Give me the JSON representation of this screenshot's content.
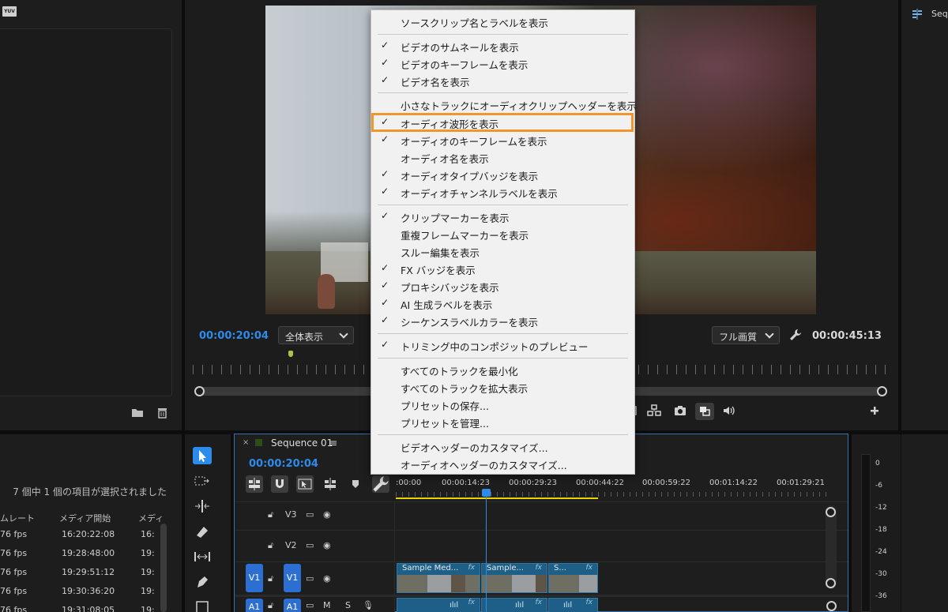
{
  "project_panel": {
    "badge": "YUV",
    "selection_status": "7 個中 1 個の項目が選択されました",
    "columns": [
      "ムレート",
      "メディア開始",
      "メディ"
    ],
    "rows": [
      [
        "76 fps",
        "16:20:22:08",
        "16:"
      ],
      [
        "76 fps",
        "19:28:48:00",
        "19:"
      ],
      [
        "76 fps",
        "19:29:51:12",
        "19:"
      ],
      [
        "76 fps",
        "19:30:36:20",
        "19:"
      ],
      [
        "76 fps",
        "19:31:08:05",
        "19:"
      ]
    ]
  },
  "program_monitor": {
    "timecode_current": "00:00:20:04",
    "fit_select": "全体表示",
    "quality_select": "フル画質",
    "timecode_duration": "00:00:45:13"
  },
  "right_panel": {
    "sequence_label": "Seq"
  },
  "timeline": {
    "sequence_name": "Sequence 01",
    "timecode": "00:00:20:04",
    "ruler": ":00:00",
    "r1": "00:00:14:23",
    "r2": "00:00:29:23",
    "r3": "00:00:44:22",
    "r4": "00:00:59:22",
    "r5": "00:01:14:22",
    "r6": "00:01:29:21",
    "tracks": {
      "v3": "V3",
      "v2": "V2",
      "v1_src": "V1",
      "v1": "V1",
      "a1_src": "A1",
      "a1": "A1"
    },
    "clips": [
      "Sample Med...",
      "Sample...",
      "S..."
    ],
    "fx": "fx"
  },
  "audio_meter": {
    "scale": [
      "0",
      "-6",
      "-12",
      "-18",
      "-24",
      "-30",
      "-36"
    ]
  },
  "context_menu": {
    "items": [
      {
        "label": "ソースクリップ名とラベルを表示",
        "checked": false
      },
      {
        "label": "ビデオのサムネールを表示",
        "checked": true
      },
      {
        "label": "ビデオのキーフレームを表示",
        "checked": true
      },
      {
        "label": "ビデオ名を表示",
        "checked": true
      },
      {
        "label": "小さなトラックにオーディオクリップヘッダーを表示",
        "checked": false
      },
      {
        "label": "オーディオ波形を表示",
        "checked": true
      },
      {
        "label": "オーディオのキーフレームを表示",
        "checked": true
      },
      {
        "label": "オーディオ名を表示",
        "checked": false
      },
      {
        "label": "オーディオタイプバッジを表示",
        "checked": true
      },
      {
        "label": "オーディオチャンネルラベルを表示",
        "checked": true
      },
      {
        "label": "クリップマーカーを表示",
        "checked": true
      },
      {
        "label": "重複フレームマーカーを表示",
        "checked": false
      },
      {
        "label": "スルー編集を表示",
        "checked": false
      },
      {
        "label": "FX バッジを表示",
        "checked": true
      },
      {
        "label": "プロキシバッジを表示",
        "checked": true
      },
      {
        "label": "AI 生成ラベルを表示",
        "checked": true
      },
      {
        "label": "シーケンスラベルカラーを表示",
        "checked": true
      },
      {
        "label": "トリミング中のコンポジットのプレビュー",
        "checked": true
      },
      {
        "label": "すべてのトラックを最小化",
        "checked": false
      },
      {
        "label": "すべてのトラックを拡大表示",
        "checked": false
      },
      {
        "label": "プリセットの保存...",
        "checked": false
      },
      {
        "label": "プリセットを管理...",
        "checked": false
      },
      {
        "label": "ビデオヘッダーのカスタマイズ...",
        "checked": false
      },
      {
        "label": "オーディオヘッダーのカスタマイズ...",
        "checked": false
      }
    ],
    "check_glyph": "✓",
    "highlight_color": "#f0962c"
  }
}
